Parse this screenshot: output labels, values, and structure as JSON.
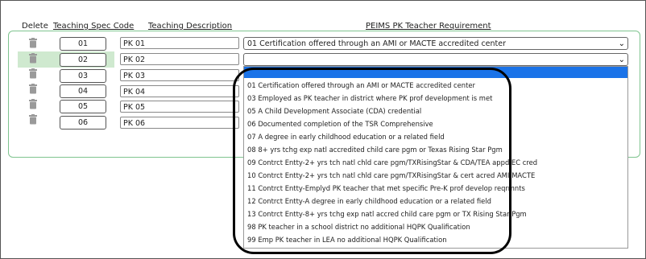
{
  "headers": {
    "delete": "Delete",
    "code": "Teaching Spec Code",
    "description": "Teaching Description",
    "requirement": "PEIMS PK Teacher Requirement"
  },
  "rows": [
    {
      "code": "01",
      "description": "PK 01",
      "requirement": "01 Certification offered through an AMI or MACTE accredited center",
      "selected": false
    },
    {
      "code": "02",
      "description": "PK 02",
      "requirement": "",
      "selected": true
    },
    {
      "code": "03",
      "description": "PK 03"
    },
    {
      "code": "04",
      "description": "PK 04"
    },
    {
      "code": "05",
      "description": "PK 05"
    },
    {
      "code": "06",
      "description": "PK 06"
    }
  ],
  "dropdown": {
    "highlighted": "",
    "options": [
      "01 Certification offered through an AMI or MACTE accredited center",
      "03 Employed as PK teacher in district where PK prof development is met",
      "05 A Child Development Associate (CDA) credential",
      "06 Documented completion of the TSR Comprehensive",
      "07 A degree in early childhood education or a related field",
      "08 8+ yrs tchg exp natl accredited child care pgm or Texas Rising Star Pgm",
      "09 Contrct Entty-2+ yrs tch natl chld care pgm/TXRisingStar & CDA/TEA appd EC cred",
      "10 Contrct Entty-2+ yrs tch natl chld care pgm/TXRisingStar & cert acred AMI/MACTE",
      "11 Contrct Entty-Emplyd PK teacher that met specific Pre-K prof develop reqrmnts",
      "12 Contrct Entty-A degree in early childhood education or a related field",
      "13 Contrct Entty-8+ yrs tchg exp natl accred child care pgm or TX Rising Star Pgm",
      "98 PK teacher in a school district no additional HQPK Qualification",
      "99 Emp PK teacher in LEA no additional HQPK Qualification"
    ]
  },
  "icons": {
    "trash": "trash-icon",
    "chevron": "chevron-down-icon"
  },
  "colors": {
    "panel_border": "#7fc48f",
    "row_highlight": "#cfe9cf",
    "option_highlight": "#1a73e8",
    "trash": "#9a9a9a"
  }
}
